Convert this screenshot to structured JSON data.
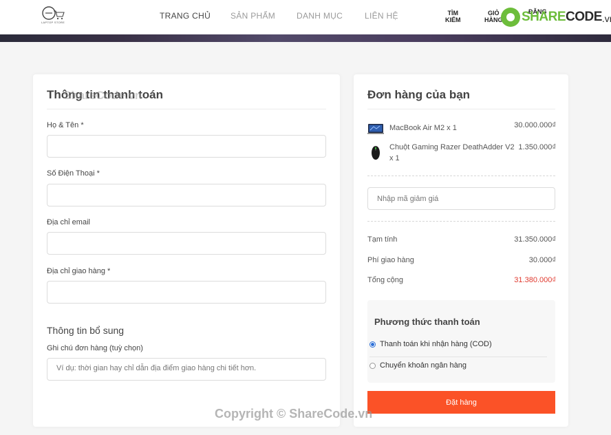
{
  "header": {
    "logo_text": "LAPTOP STORE",
    "nav": [
      {
        "label": "TRANG CHỦ",
        "active": true
      },
      {
        "label": "SẢN PHẨM",
        "active": false
      },
      {
        "label": "DANH MỤC",
        "active": false
      },
      {
        "label": "LIÊN HỆ",
        "active": false
      }
    ],
    "search_line1": "TÌM",
    "search_line2": "KIẾM",
    "cart_line1": "GIỎ",
    "cart_line2": "HÀNG",
    "account_line1": "ĐĂNG",
    "brand_share": "SHARE",
    "brand_code": "CODE",
    "brand_tld": ".vn"
  },
  "billing": {
    "title": "Thông tin thanh toán",
    "watermark": "ShareCode.vn",
    "fullname_label": "Họ & Tên *",
    "phone_label": "Số Điện Thoại *",
    "email_label": "Địa chỉ email",
    "address_label": "Địa chỉ giao hàng *",
    "extra_title": "Thông tin bổ sung",
    "note_label": "Ghi chú đơn hàng (tuỳ chọn)",
    "note_placeholder": "Ví dụ: thời gian hay chỉ dẫn địa điểm giao hàng chi tiết hơn."
  },
  "order": {
    "title": "Đơn hàng của bạn",
    "items": [
      {
        "name": "MacBook Air M2 x 1",
        "price": "30.000.000₫",
        "icon": "laptop-thumbnail"
      },
      {
        "name": "Chuột Gaming Razer DeathAdder V2 x 1",
        "price": "1.350.000₫",
        "icon": "mouse-thumbnail"
      }
    ],
    "coupon_placeholder": "Nhập mã giảm giá",
    "subtotal_label": "Tạm tính",
    "subtotal_value": "31.350.000₫",
    "shipping_label": "Phí giao hàng",
    "shipping_value": "30.000₫",
    "total_label": "Tổng cộng",
    "total_value": "31.380.000₫",
    "payment_title": "Phương thức thanh toán",
    "payment_options": [
      {
        "label": "Thanh toán khi nhận hàng (COD)",
        "selected": true
      },
      {
        "label": "Chuyển khoản ngân hàng",
        "selected": false
      }
    ],
    "submit_label": "Đặt hàng"
  },
  "footer": {
    "copyright": "Copyright © ShareCode.vn"
  },
  "colors": {
    "accent": "#fb5227",
    "total": "#e03a2f",
    "radio": "#2d6fd6",
    "brand_green": "#6dbd3b"
  }
}
